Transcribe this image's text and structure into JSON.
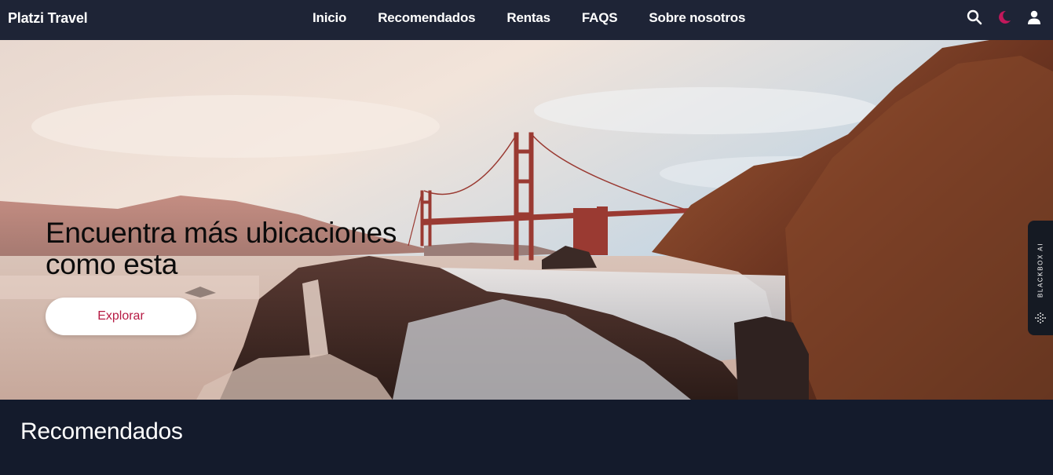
{
  "header": {
    "brand": "Platzi Travel",
    "nav": [
      "Inicio",
      "Recomendados",
      "Rentas",
      "FAQS",
      "Sobre nosotros"
    ],
    "icons": [
      "search-icon",
      "moon-icon",
      "user-icon"
    ],
    "accent": "#c2185b"
  },
  "hero": {
    "title": "Encuentra más ubicaciones como esta",
    "button_label": "Explorar"
  },
  "widget": {
    "label": "BLACKBOX AI"
  },
  "section": {
    "title": "Recomendados"
  },
  "colors": {
    "topbar": "#1e2436",
    "background": "#141b2c",
    "button_text": "#b61a43"
  }
}
